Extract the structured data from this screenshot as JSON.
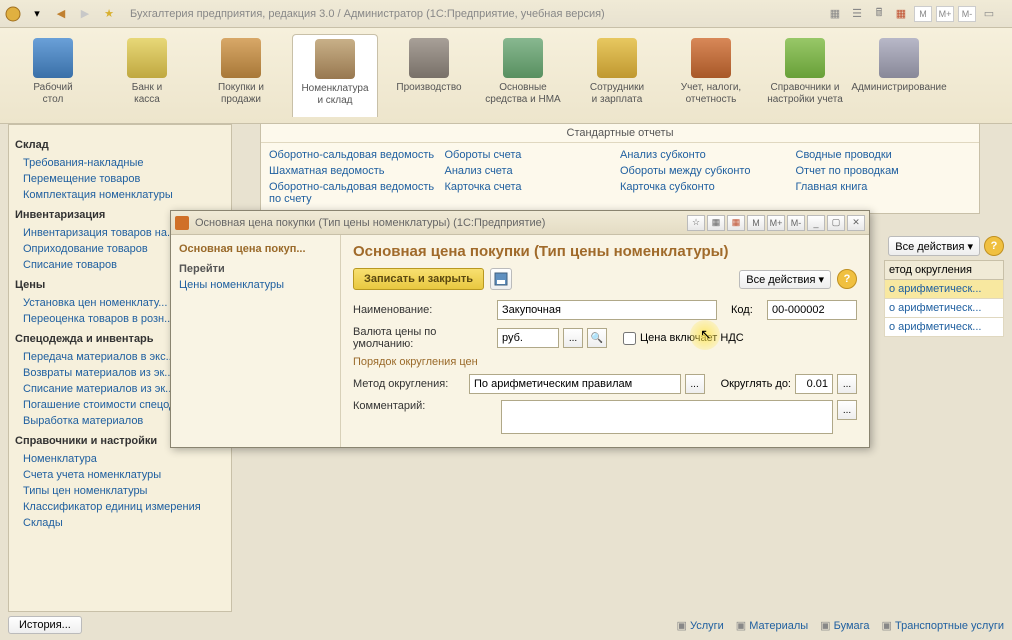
{
  "app": {
    "title": "Бухгалтерия предприятия, редакция 3.0 / Администратор   (1С:Предприятие, учебная версия)"
  },
  "memory_chips": [
    "M",
    "M+",
    "M-"
  ],
  "ribbon": [
    {
      "label": "Рабочий\nстол"
    },
    {
      "label": "Банк и\nкасса"
    },
    {
      "label": "Покупки и\nпродажи"
    },
    {
      "label": "Номенклатура\nи склад"
    },
    {
      "label": "Производство"
    },
    {
      "label": "Основные\nсредства и НМА"
    },
    {
      "label": "Сотрудники\nи зарплата"
    },
    {
      "label": "Учет, налоги,\nотчетность"
    },
    {
      "label": "Справочники и\nнастройки учета"
    },
    {
      "label": "Администрирование"
    }
  ],
  "sidebar": {
    "groups": [
      {
        "title": "Склад",
        "items": [
          "Требования-накладные",
          "Перемещение товаров",
          "Комплектация номенклатуры"
        ]
      },
      {
        "title": "Инвентаризация",
        "items": [
          "Инвентаризация товаров на...",
          "Оприходование товаров",
          "Списание товаров"
        ]
      },
      {
        "title": "Цены",
        "items": [
          "Установка цен номенклату...",
          "Переоценка товаров в розн..."
        ]
      },
      {
        "title": "Спецодежда и инвентарь",
        "items": [
          "Передача материалов в экс...",
          "Возвраты материалов из эк...",
          "Списание материалов из эк...",
          "Погашение стоимости спецодежды...",
          "Выработка материалов"
        ]
      },
      {
        "title": "Справочники и настройки",
        "items": [
          "Номенклатура",
          "Счета учета номенклатуры",
          "Типы цен номенклатуры",
          "Классификатор единиц измерения",
          "Склады"
        ]
      }
    ]
  },
  "reports": {
    "title": "Стандартные отчеты",
    "cols": [
      [
        "Оборотно-сальдовая ведомость",
        "Шахматная ведомость",
        "Оборотно-сальдовая ведомость по счету"
      ],
      [
        "Обороты счета",
        "Анализ счета",
        "Карточка счета"
      ],
      [
        "Анализ субконто",
        "Обороты между субконто",
        "Карточка субконто"
      ],
      [
        "Сводные проводки",
        "Отчет по проводкам",
        "Главная книга"
      ]
    ]
  },
  "list": {
    "actions_label": "Все действия",
    "header": "етод округления",
    "rows": [
      "о арифметическ...",
      "о арифметическ...",
      "о арифметическ..."
    ]
  },
  "dialog": {
    "title": "Основная цена покупки (Тип цены номенклатуры)  (1С:Предприятие)",
    "nav_title": "Основная цена покуп...",
    "nav_sub": "Перейти",
    "nav_link": "Цены номенклатуры",
    "form_title": "Основная цена покупки (Тип цены номенклатуры)",
    "save_close": "Записать и закрыть",
    "all_actions": "Все действия",
    "labels": {
      "name": "Наименование:",
      "code": "Код:",
      "currency": "Валюта цены по умолчанию:",
      "vat": "Цена включает НДС",
      "rounding_section": "Порядок округления цен",
      "method": "Метод округления:",
      "round_to": "Округлять до:",
      "comment": "Комментарий:"
    },
    "values": {
      "name": "Закупочная",
      "code": "00-000002",
      "currency": "руб.",
      "method": "По арифметическим правилам",
      "round_to": "0.01",
      "comment": ""
    }
  },
  "statusbar": {
    "history": "История...",
    "items": [
      "Услуги",
      "Материалы",
      "Бумага",
      "Транспортные услуги"
    ]
  }
}
